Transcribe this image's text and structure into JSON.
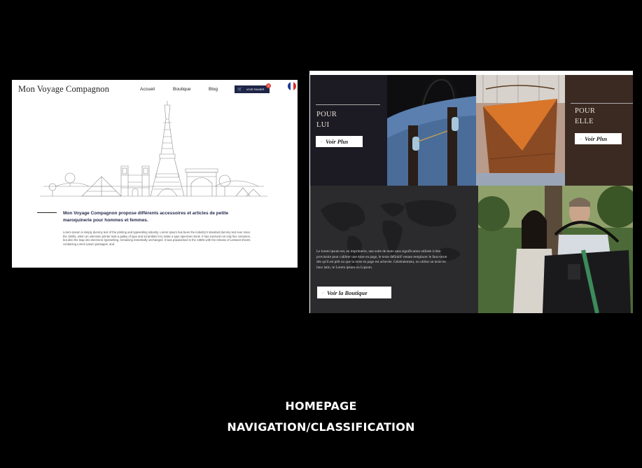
{
  "site": {
    "brand": "Mon Voyage Compagnon",
    "nav": [
      "Accueil",
      "Boutique",
      "Blog"
    ],
    "cart_label": "VOIR PANIER",
    "cart_count": "3",
    "intro_title": "Mon Voyage Compagnon propose différents accessoires et articles de petite maroquinerie pour hommes et femmes.",
    "intro_body": "Lorem Ipsum is simply dummy text of the printing and typesetting industry. Lorem Ipsum has been the industry's standard dummy text ever since the 1500s, when an unknown printer took a galley of type and scrambled it to make a type specimen book. It has survived not only five centuries, but also the leap into electronic typesetting, remaining essentially unchanged. It was popularised in the 1960s with the release of Letraset sheets containing Lorem Ipsum passages, and",
    "flag_icon": "france-flag-icon",
    "cart_icon": "cart-icon"
  },
  "grid": {
    "lui_title_1": "POUR",
    "lui_title_2": "LUI",
    "elle_title_1": "POUR",
    "elle_title_2": "ELLE",
    "voir_plus": "Voir Plus",
    "map_text": "Le lorem ipsum est, en imprimerie, une suite de mots sans signification utilisée à titre provisoire pour calibrer une mise en page, le texte définitif venant remplacer le faux-texte dès qu'il est prêt ou que la mise en page est achevée. Généralement, on utilise un texte en faux latin, le Lorem ipsum ou Lipsum.",
    "voir_boutique": "Voir la Boutique"
  },
  "captions": {
    "line1": "HOMEPAGE",
    "line2": "NAVIGATION/CLASSIFICATION"
  },
  "colors": {
    "navy": "#1f2548",
    "badge": "#e0443a",
    "background": "#000000"
  }
}
